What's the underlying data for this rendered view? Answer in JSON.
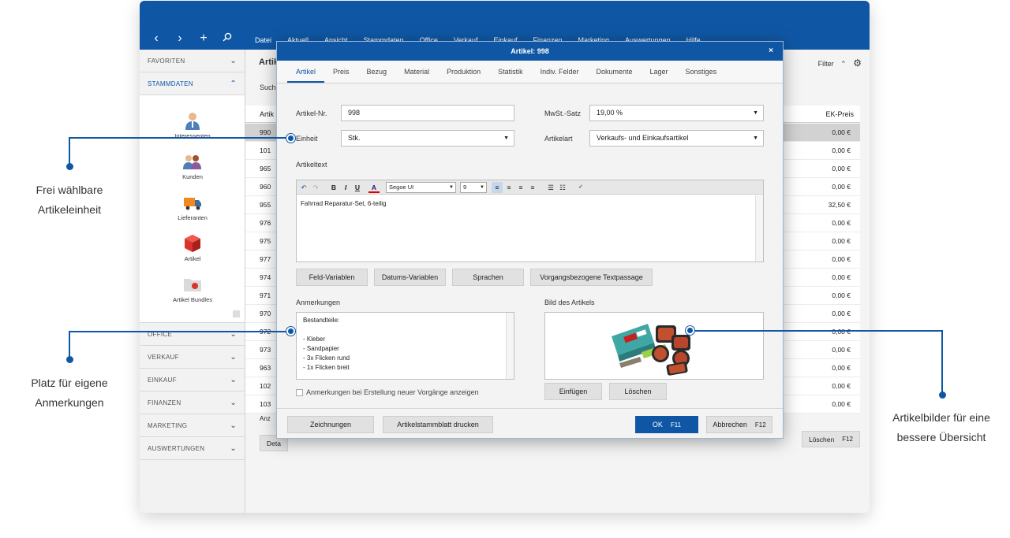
{
  "menu": [
    "Datei",
    "Aktuell",
    "Ansicht",
    "Stammdaten",
    "Office",
    "Verkauf",
    "Einkauf",
    "Finanzen",
    "Marketing",
    "Auswertungen",
    "Hilfe"
  ],
  "sidebar": {
    "favoriten": "FAVORITEN",
    "stammdaten": "STAMMDATEN",
    "items": [
      "Interessenten",
      "Kunden",
      "Lieferanten",
      "Artikel",
      "Artikel Bundles"
    ],
    "sections": [
      "OFFICE",
      "VERKAUF",
      "EINKAUF",
      "FINANZEN",
      "MARKETING",
      "AUSWERTUNGEN"
    ]
  },
  "list": {
    "title": "Artik",
    "search": "Such",
    "filter": "Filter",
    "col_nr": "Artik",
    "col_price": "EK-Preis",
    "rows": [
      {
        "nr": "990",
        "price": "0,00 €"
      },
      {
        "nr": "101",
        "price": "0,00 €"
      },
      {
        "nr": "965",
        "price": "0,00 €"
      },
      {
        "nr": "960",
        "price": "0,00 €"
      },
      {
        "nr": "955",
        "price": "32,50 €"
      },
      {
        "nr": "976",
        "price": "0,00 €"
      },
      {
        "nr": "975",
        "price": "0,00 €"
      },
      {
        "nr": "977",
        "price": "0,00 €"
      },
      {
        "nr": "974",
        "price": "0,00 €"
      },
      {
        "nr": "971",
        "price": "0,00 €"
      },
      {
        "nr": "970",
        "price": "0,00 €"
      },
      {
        "nr": "972",
        "price": "0,00 €"
      },
      {
        "nr": "973",
        "price": "0,00 €"
      },
      {
        "nr": "963",
        "price": "0,00 €"
      },
      {
        "nr": "102",
        "price": "0,00 €"
      },
      {
        "nr": "103",
        "price": "0,00 €"
      }
    ],
    "anz": "Anz",
    "btn_details": "Deta",
    "btn_loeschen": "Löschen",
    "key_f12": "F12"
  },
  "dialog": {
    "title": "Artikel: 998",
    "close": "×",
    "tabs": [
      "Artikel",
      "Preis",
      "Bezug",
      "Material",
      "Produktion",
      "Statistik",
      "Indiv. Felder",
      "Dokumente",
      "Lager",
      "Sonstiges"
    ],
    "artikel_nr_label": "Artikel-Nr.",
    "artikel_nr": "998",
    "mwst_label": "MwSt.-Satz",
    "mwst": "19,00 %",
    "einheit_label": "Einheit",
    "einheit": "Stk.",
    "artikelart_label": "Artikelart",
    "artikelart": "Verkaufs- und Einkaufsartikel",
    "artikeltext_label": "Artikeltext",
    "font": "Segoe UI",
    "font_size": "9",
    "artikeltext": "Fahrrad Reparatur-Set, 6-teilig",
    "btn_feld": "Feld-Variablen",
    "btn_datum": "Datums-Variablen",
    "btn_sprachen": "Sprachen",
    "btn_vorgang": "Vorgangsbezogene Textpassage",
    "anmerkungen_label": "Anmerkungen",
    "anmerkungen": "Bestandteile:\n\n- Kleber\n- Sandpapier\n- 3x Flicken rund\n- 1x Flicken breit",
    "bild_label": "Bild des Artikels",
    "btn_einfuegen": "Einfügen",
    "btn_loeschen": "Löschen",
    "chk_label": "Anmerkungen bei Erstellung neuer Vorgänge anzeigen",
    "btn_zeichnungen": "Zeichnungen",
    "btn_stammblatt": "Artikelstammblatt drucken",
    "btn_ok": "OK",
    "key_ok": "F11",
    "btn_abbrechen": "Abbrechen",
    "key_abbrechen": "F12"
  },
  "callouts": {
    "einheit_l1": "Frei wählbare",
    "einheit_l2": "Artikeleinheit",
    "anm_l1": "Platz für eigene",
    "anm_l2": "Anmerkungen",
    "bild_l1": "Artikelbilder für eine",
    "bild_l2": "bessere Übersicht"
  },
  "colors": {
    "accent": "#0f57a5"
  }
}
